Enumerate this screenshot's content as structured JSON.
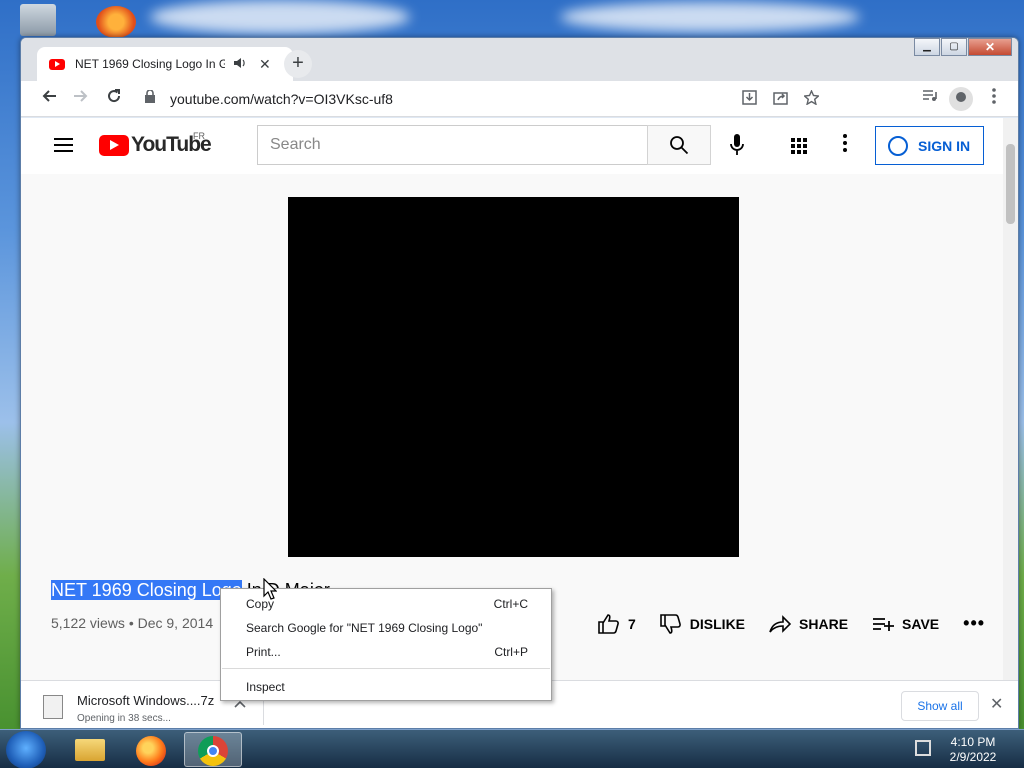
{
  "browser": {
    "tab": {
      "title": "NET 1969 Closing Logo In G",
      "audio_icon": "speaker-icon",
      "close_glyph": "✕"
    },
    "new_tab_glyph": "+",
    "window_buttons": {
      "minimize": "▁",
      "maximize": "▢",
      "close": "✕"
    },
    "url": "youtube.com/watch?v=OI3VKsc-uf8"
  },
  "youtube": {
    "logo_text": "YouTube",
    "country": "FR",
    "search_placeholder": "Search",
    "signin_label": "SIGN IN",
    "video": {
      "title_selected": "NET 1969 Closing Logo",
      "title_rest": " In D Major",
      "meta": "5,122 views • Dec 9, 2014",
      "likes": "7",
      "dislike_label": "DISLIKE",
      "share_label": "SHARE",
      "save_label": "SAVE",
      "more_glyph": "•••"
    }
  },
  "context_menu": {
    "items": [
      {
        "label": "Copy",
        "shortcut": "Ctrl+C"
      },
      {
        "label": "Search Google for \"NET 1969 Closing Logo\"",
        "shortcut": ""
      },
      {
        "label": "Print...",
        "shortcut": "Ctrl+P"
      },
      {
        "label": "Inspect",
        "shortcut": ""
      }
    ]
  },
  "downloads": {
    "file_name": "Microsoft Windows....7z",
    "status": "Opening in 38 secs...",
    "show_all_label": "Show all",
    "close_glyph": "✕"
  },
  "taskbar": {
    "time": "4:10 PM",
    "date": "2/9/2022"
  },
  "colors": {
    "youtube_red": "#ff0000",
    "signin_blue": "#065fd4",
    "selection_blue": "#3478f6"
  }
}
